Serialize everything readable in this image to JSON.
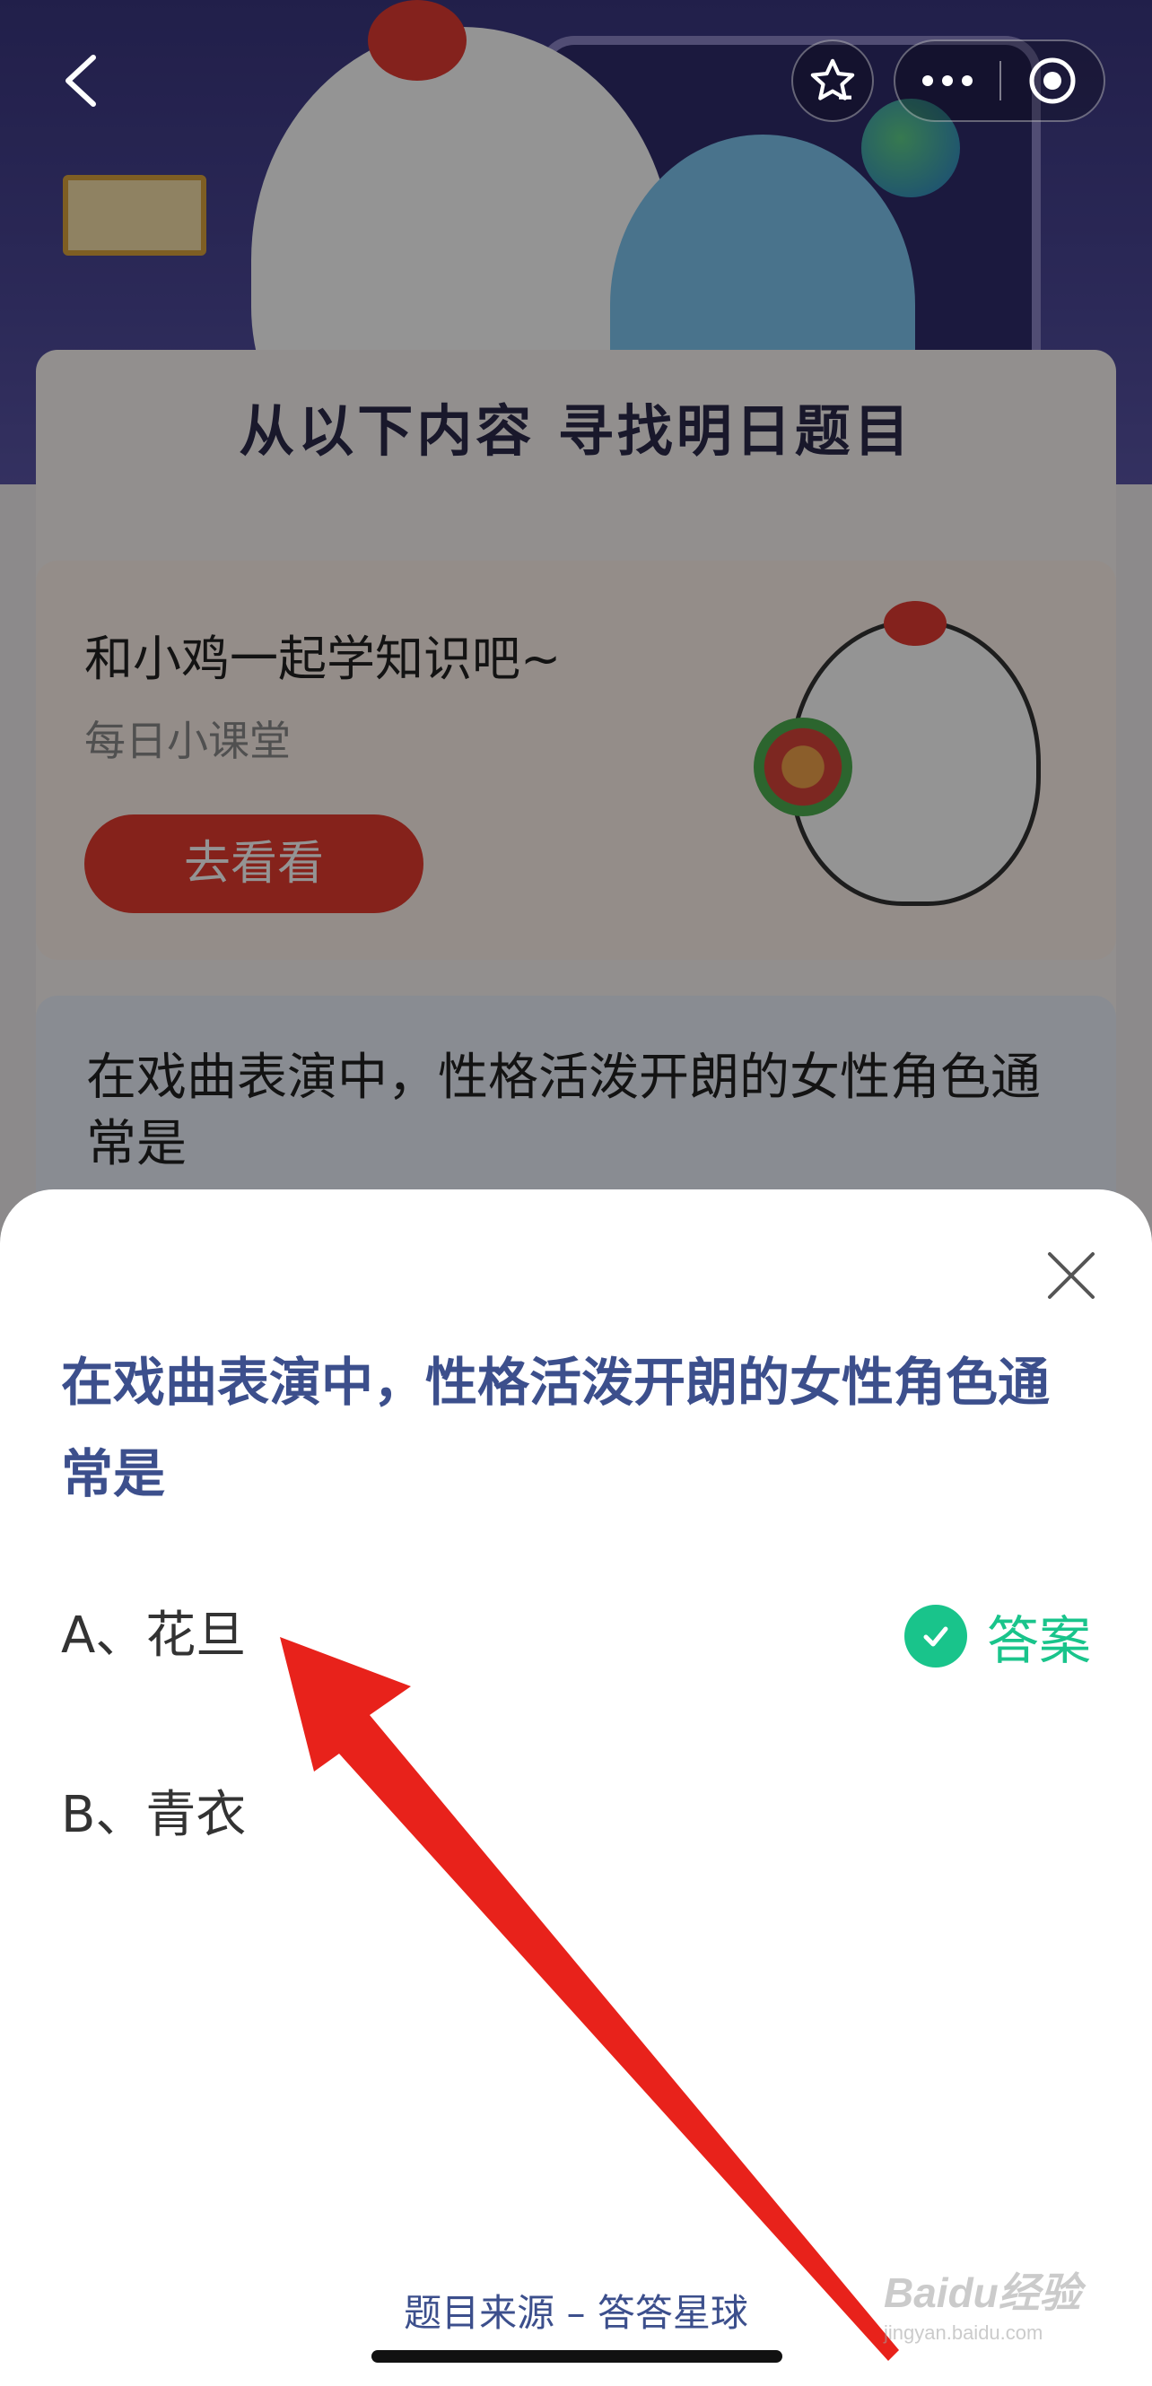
{
  "background": {
    "headline": "从以下内容 寻找明日题目",
    "promo": {
      "title": "和小鸡一起学知识吧~",
      "subtitle": "每日小课堂",
      "button_label": "去看看"
    },
    "question_preview": "在戏曲表演中，性格活泼开朗的女性角色通常是"
  },
  "nav": {
    "back_icon": "chevron-left-icon",
    "favorite_icon": "star-icon",
    "more_icon": "more-dots-icon",
    "target_icon": "target-icon"
  },
  "sheet": {
    "question": "在戏曲表演中，性格活泼开朗的女性角色通常是",
    "options": [
      {
        "text": "A、花旦",
        "is_answer": true
      },
      {
        "text": "B、青衣",
        "is_answer": false
      }
    ],
    "answer_label": "答案",
    "source": "题目来源 – 答答星球"
  },
  "watermark": {
    "main": "Baidu经验",
    "sub": "jingyan.baidu.com"
  },
  "colors": {
    "accent_blue": "#3c4f8c",
    "answer_green": "#19c48b",
    "promo_red": "#e53b2f",
    "arrow_red": "#e8221b"
  }
}
